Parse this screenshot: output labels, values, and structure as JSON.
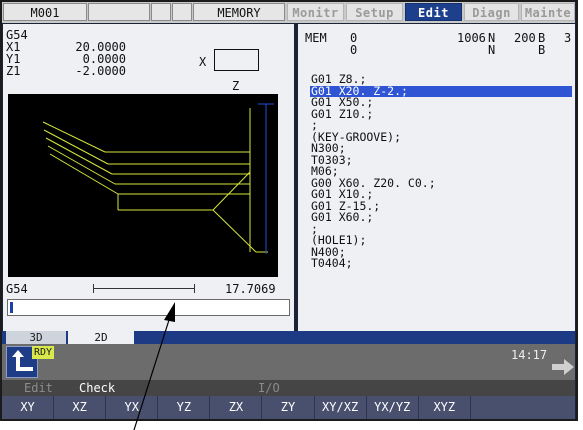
{
  "top": {
    "program": "M001",
    "mode": "MEMORY",
    "tabs": [
      {
        "label": "Monitr",
        "active": false
      },
      {
        "label": "Setup",
        "active": false
      },
      {
        "label": "Edit",
        "active": true
      },
      {
        "label": "Diagn",
        "active": false
      },
      {
        "label": "Mainte",
        "active": false
      }
    ]
  },
  "position": {
    "coord": "G54",
    "axes": [
      {
        "name": "X1",
        "value": "20.0000"
      },
      {
        "name": "Y1",
        "value": "0.0000"
      },
      {
        "name": "Z1",
        "value": "-2.0000"
      }
    ],
    "plane_h": "X",
    "plane_v": "Z"
  },
  "graph_footer": {
    "coord": "G54",
    "scale": "17.7069"
  },
  "program_header": {
    "mode": "MEM",
    "o1": "0",
    "o2": "0",
    "n1": "1006",
    "n_label": "N",
    "n2": "200",
    "b_label": "B",
    "b_val": "3",
    "n_label2": "N",
    "b_label2": "B"
  },
  "program_lines": [
    "G01 Z8.;",
    "G01 X20. Z-2.;",
    "G01 X50.;",
    "G01 Z10.;",
    ";",
    "(KEY-GROOVE);",
    "N300;",
    "T0303;",
    "M06;",
    "G00 X60. Z20. C0.;",
    "G01 X10.;",
    "G01 Z-15.;",
    "G01 X60.;",
    ";",
    "(HOLE1);",
    "N400;",
    "T0404;"
  ],
  "selected_line": 1,
  "view_tabs": [
    {
      "label": "3D",
      "active": false
    },
    {
      "label": "2D",
      "active": true
    }
  ],
  "status": {
    "ready": "RDY",
    "time": "14:17"
  },
  "mode_bar": {
    "edit": "Edit",
    "check": "Check",
    "io": "I/O"
  },
  "softkeys": [
    "XY",
    "XZ",
    "YX",
    "YZ",
    "ZX",
    "ZY",
    "XY/XZ",
    "YX/YZ",
    "XYZ",
    ""
  ],
  "colors": {
    "toolpath": "#d8e63a",
    "axis_line": "#1f4fd6",
    "tab_active": "#1e3f8c",
    "selection": "#2f55d4"
  }
}
